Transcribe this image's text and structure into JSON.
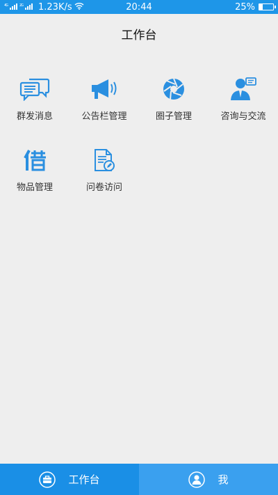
{
  "status": {
    "left_indicators": "1.23K/s",
    "time": "20:44",
    "battery_text": "25%",
    "battery_level": 0.25
  },
  "header": {
    "title": "工作台"
  },
  "tiles": [
    {
      "label": "群发消息",
      "icon": "chat-bubbles-icon"
    },
    {
      "label": "公告栏管理",
      "icon": "megaphone-icon"
    },
    {
      "label": "圈子管理",
      "icon": "aperture-icon"
    },
    {
      "label": "咨询与交流",
      "icon": "consultant-icon"
    },
    {
      "label": "物品管理",
      "icon": "borrow-icon"
    },
    {
      "label": "问卷访问",
      "icon": "questionnaire-icon"
    }
  ],
  "tabbar": {
    "workbench_label": "工作台",
    "me_label": "我"
  },
  "colors": {
    "status_bar": "#1e96e8",
    "icon_blue": "#2a8fe0",
    "tab_active": "#1a8fe6",
    "tab_inactive": "#3aa0ef",
    "background": "#eeeeee"
  }
}
